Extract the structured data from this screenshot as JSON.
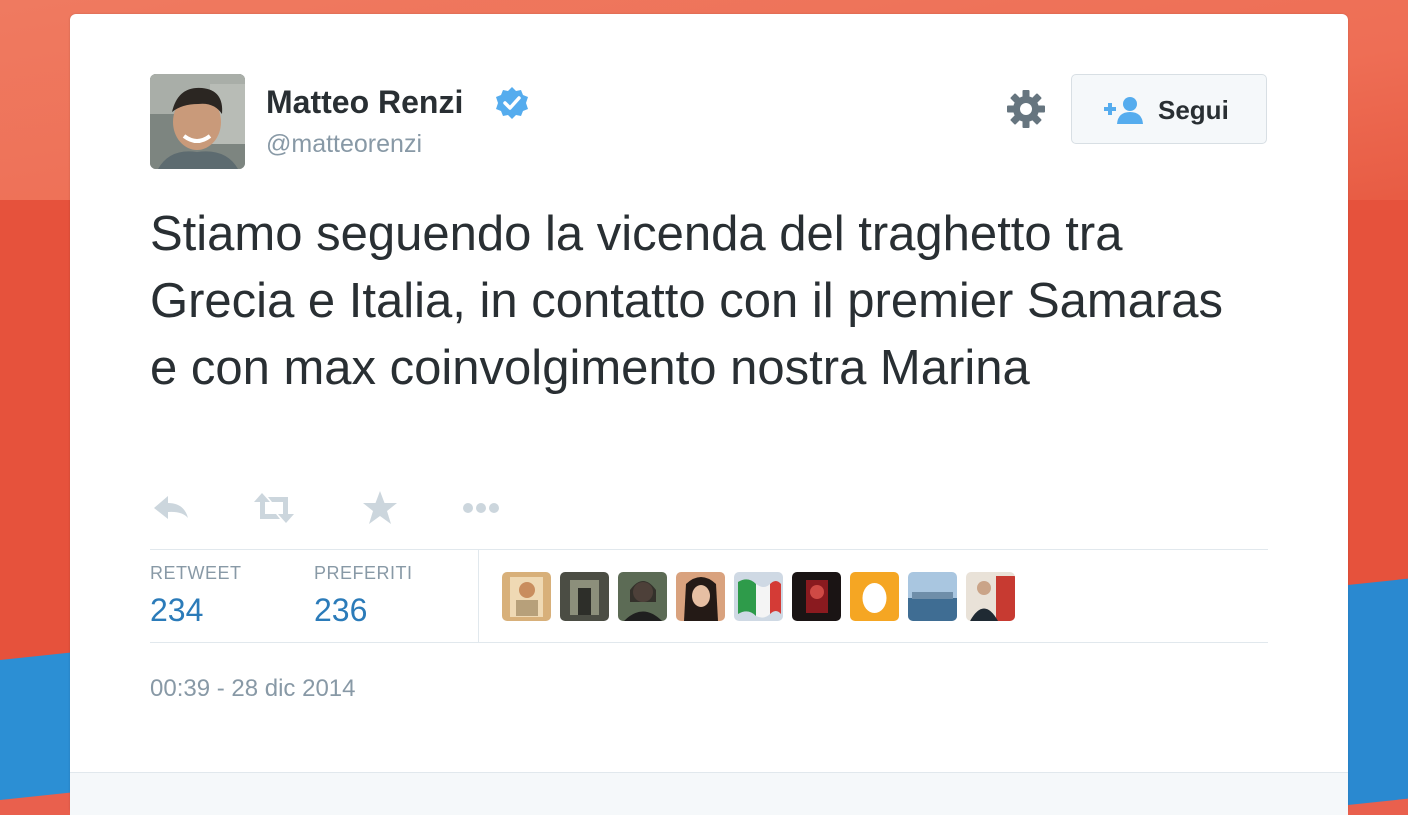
{
  "tweet": {
    "author_name": "Matteo Renzi",
    "author_handle": "@matteorenzi",
    "text": "Stiamo seguendo la vicenda del traghetto tra Grecia e Italia, in contatto con il premier Samaras e con max coinvolgimento nostra Marina",
    "follow_label": "Segui",
    "stats": {
      "retweet_label": "RETWEET",
      "retweet_count": "234",
      "favorites_label": "PREFERITI",
      "favorites_count": "236"
    },
    "timestamp": "00:39 - 28 dic 2014"
  },
  "icons": {
    "verified": "verified-badge-icon",
    "settings": "gear-icon",
    "follow": "add-user-icon",
    "reply": "reply-icon",
    "retweet": "retweet-icon",
    "favorite": "star-icon",
    "more": "more-icon"
  },
  "colors": {
    "text": "#292f33",
    "muted": "#8899a6",
    "link": "#2b7bb9",
    "verified": "#55acee",
    "action_icon": "#ccd6dd"
  }
}
